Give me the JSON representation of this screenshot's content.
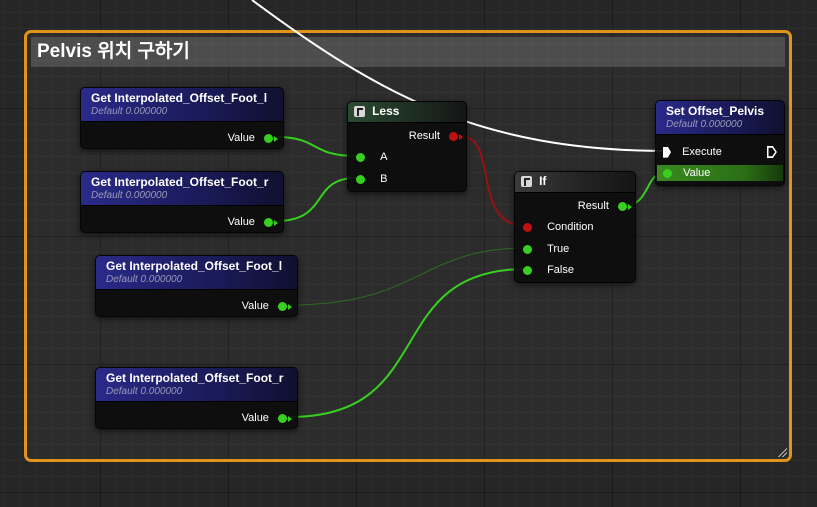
{
  "comment": {
    "title": "Pelvis 위치 구하기"
  },
  "nodes": {
    "get_l1": {
      "title": "Get Interpolated_Offset_Foot_l",
      "subtitle": "Default 0.000000",
      "out": "Value"
    },
    "get_r1": {
      "title": "Get Interpolated_Offset_Foot_r",
      "subtitle": "Default 0.000000",
      "out": "Value"
    },
    "get_l2": {
      "title": "Get Interpolated_Offset_Foot_l",
      "subtitle": "Default 0.000000",
      "out": "Value"
    },
    "get_r2": {
      "title": "Get Interpolated_Offset_Foot_r",
      "subtitle": "Default 0.000000",
      "out": "Value"
    },
    "less": {
      "title": "Less",
      "result": "Result",
      "a": "A",
      "b": "B"
    },
    "if": {
      "title": "If",
      "result": "Result",
      "condition": "Condition",
      "true": "True",
      "false": "False"
    },
    "set": {
      "title": "Set Offset_Pelvis",
      "subtitle": "Default 0.000000",
      "execute": "Execute",
      "value": "Value"
    }
  },
  "colors": {
    "float_wire": "#38d020",
    "bool_wire": "#9a1010",
    "exec_wire": "#ffffff",
    "comment_border": "#e0951a"
  },
  "icons": [
    "function-icon",
    "exec-pin-icon",
    "float-pin-icon",
    "bool-pin-icon"
  ]
}
